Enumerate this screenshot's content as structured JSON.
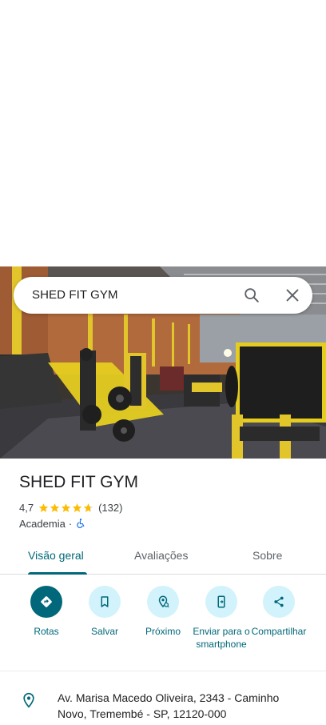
{
  "search": {
    "query": "SHED FIT GYM"
  },
  "place": {
    "name": "SHED FIT GYM",
    "rating": "4,7",
    "rating_value": 4.7,
    "review_count": "(132)",
    "category": "Academia",
    "separator": "·"
  },
  "tabs": [
    {
      "label": "Visão geral",
      "active": true
    },
    {
      "label": "Avaliações",
      "active": false
    },
    {
      "label": "Sobre",
      "active": false
    }
  ],
  "actions": [
    {
      "label": "Rotas",
      "icon": "directions-icon"
    },
    {
      "label": "Salvar",
      "icon": "bookmark-icon"
    },
    {
      "label": "Próximo",
      "icon": "nearby-icon"
    },
    {
      "label": "Enviar para o smartphone",
      "icon": "send-to-phone-icon"
    },
    {
      "label": "Compartilhar",
      "icon": "share-icon"
    }
  ],
  "address": {
    "text": "Av. Marisa Macedo Oliveira, 2343 - Caminho Novo, Tremembé - SP, 12120-000"
  },
  "colors": {
    "accent": "#00687a",
    "accent_light": "#d2f3fb",
    "star": "#fbbc04",
    "accessibility": "#1a73e8"
  }
}
